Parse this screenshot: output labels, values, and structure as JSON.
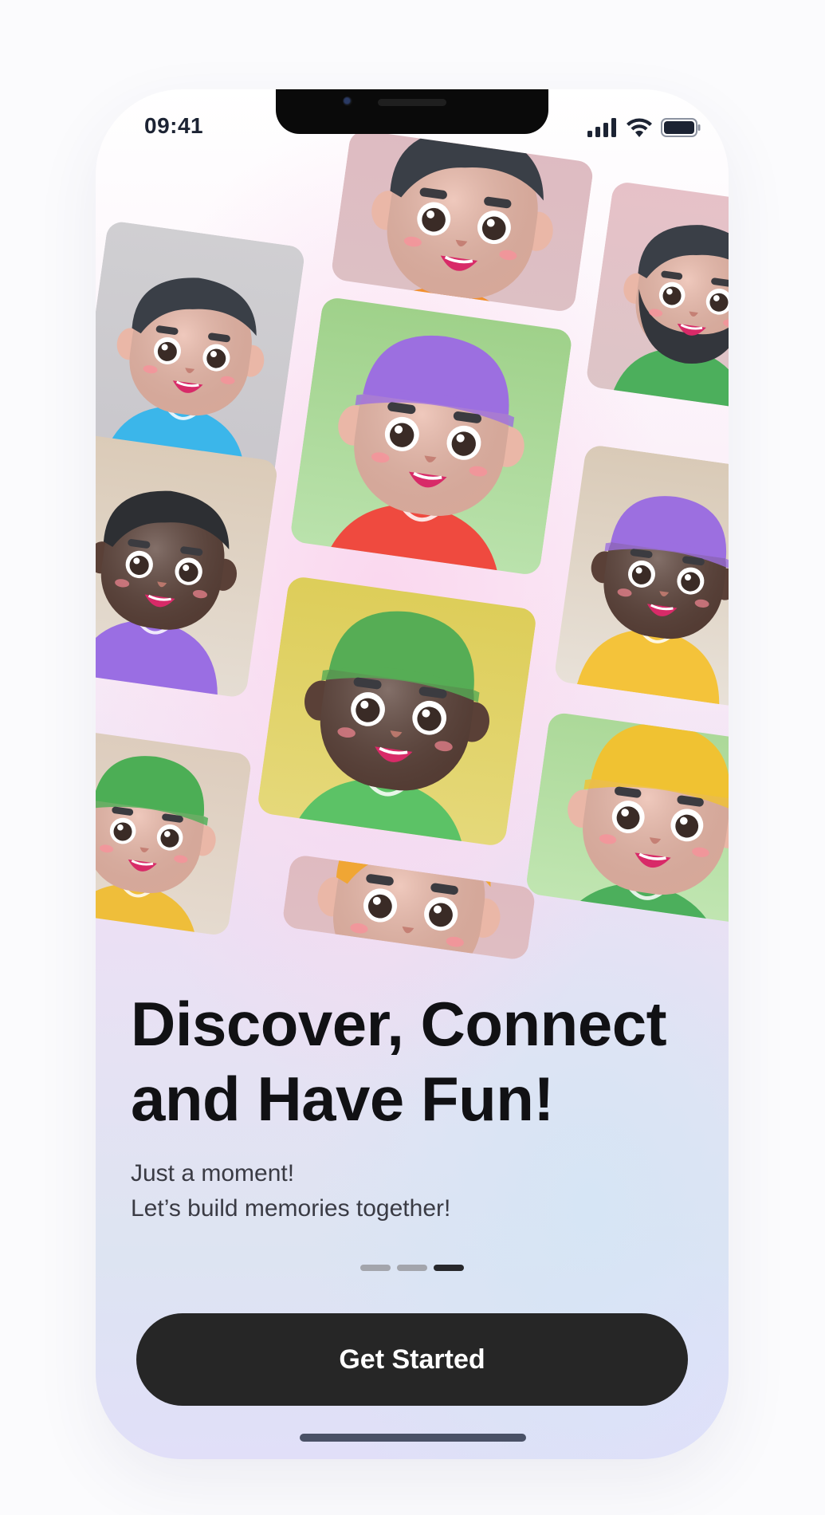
{
  "status_bar": {
    "time": "09:41",
    "icons": [
      "signal-icon",
      "wifi-icon",
      "battery-icon"
    ]
  },
  "avatars": [
    {
      "name": "avatar-gray-blue-shirt",
      "bg": [
        "#d0cfd2",
        "#c9c7cc"
      ],
      "skin": "#eab7a7",
      "hair": "#3a3f47",
      "hat": "",
      "shirt": "#3bb6ea",
      "beard": false
    },
    {
      "name": "avatar-pink-orange-hoodie",
      "bg": [
        "#dfb9c0",
        "#dcc2c6"
      ],
      "skin": "#eab7a7",
      "hair": "#3a3f47",
      "hat": "",
      "shirt": "#f2902d",
      "beard": false
    },
    {
      "name": "avatar-pink-beard",
      "bg": [
        "#e7c1c8",
        "#dcc5c7"
      ],
      "skin": "#eab7a7",
      "hair": "#3a3f47",
      "hat": "",
      "shirt": "#4caf5c",
      "beard": true
    },
    {
      "name": "avatar-beige-purple-hoodie",
      "bg": [
        "#dbcbb8",
        "#e5ddd3"
      ],
      "skin": "#5a4037",
      "hair": "#2d2f33",
      "hat": "",
      "shirt": "#9a6ee3",
      "beard": false
    },
    {
      "name": "avatar-green-purple-cap",
      "bg": [
        "#9ccf86",
        "#bde4b0"
      ],
      "skin": "#eab7a7",
      "hair": "#3a3f47",
      "hat": "#9c6fe0",
      "shirt": "#ef4a3f",
      "beard": false
    },
    {
      "name": "avatar-beige-purple-beanie",
      "bg": [
        "#d9cab7",
        "#e8e1d8"
      ],
      "skin": "#5a4037",
      "hair": "#2d2f33",
      "hat": "#9c6fe0",
      "shirt": "#f4c33a",
      "beard": false
    },
    {
      "name": "avatar-beige-green-bucket-hat",
      "bg": [
        "#dccbbb",
        "#e6dcd1"
      ],
      "skin": "#eab7a7",
      "hair": "#3a3f47",
      "hat": "#4cae55",
      "shirt": "#efbe3a",
      "beard": false
    },
    {
      "name": "avatar-yellow-green-cap",
      "bg": [
        "#dccc55",
        "#e6da7e"
      ],
      "skin": "#5a4037",
      "hair": "#2d2f33",
      "hat": "#56ad55",
      "shirt": "#5cc266",
      "beard": false
    },
    {
      "name": "avatar-green-yellow-beanie",
      "bg": [
        "#a6d592",
        "#c6e9b8"
      ],
      "skin": "#eab7a7",
      "hair": "#3a3f47",
      "hat": "#f0c232",
      "shirt": "#4caf5c",
      "beard": false
    },
    {
      "name": "avatar-pink-orange-hair",
      "bg": [
        "#dfb6bd",
        "#dfc2c6"
      ],
      "skin": "#eab7a7",
      "hair": "#f0a634",
      "hat": "",
      "shirt": "#eab7a7",
      "beard": false
    }
  ],
  "onboarding": {
    "title_line1": "Discover, Connect",
    "title_line2": "and Have Fun!",
    "subtitle_line1": "Just a moment!",
    "subtitle_line2": "Let’s build memories together!",
    "page_count": 3,
    "active_page": 3
  },
  "cta": {
    "label": "Get Started"
  },
  "colors": {
    "primary_button": "#262626",
    "headline": "#111114",
    "dot_inactive": "#a3a5ac",
    "dot_active": "#27282c"
  }
}
